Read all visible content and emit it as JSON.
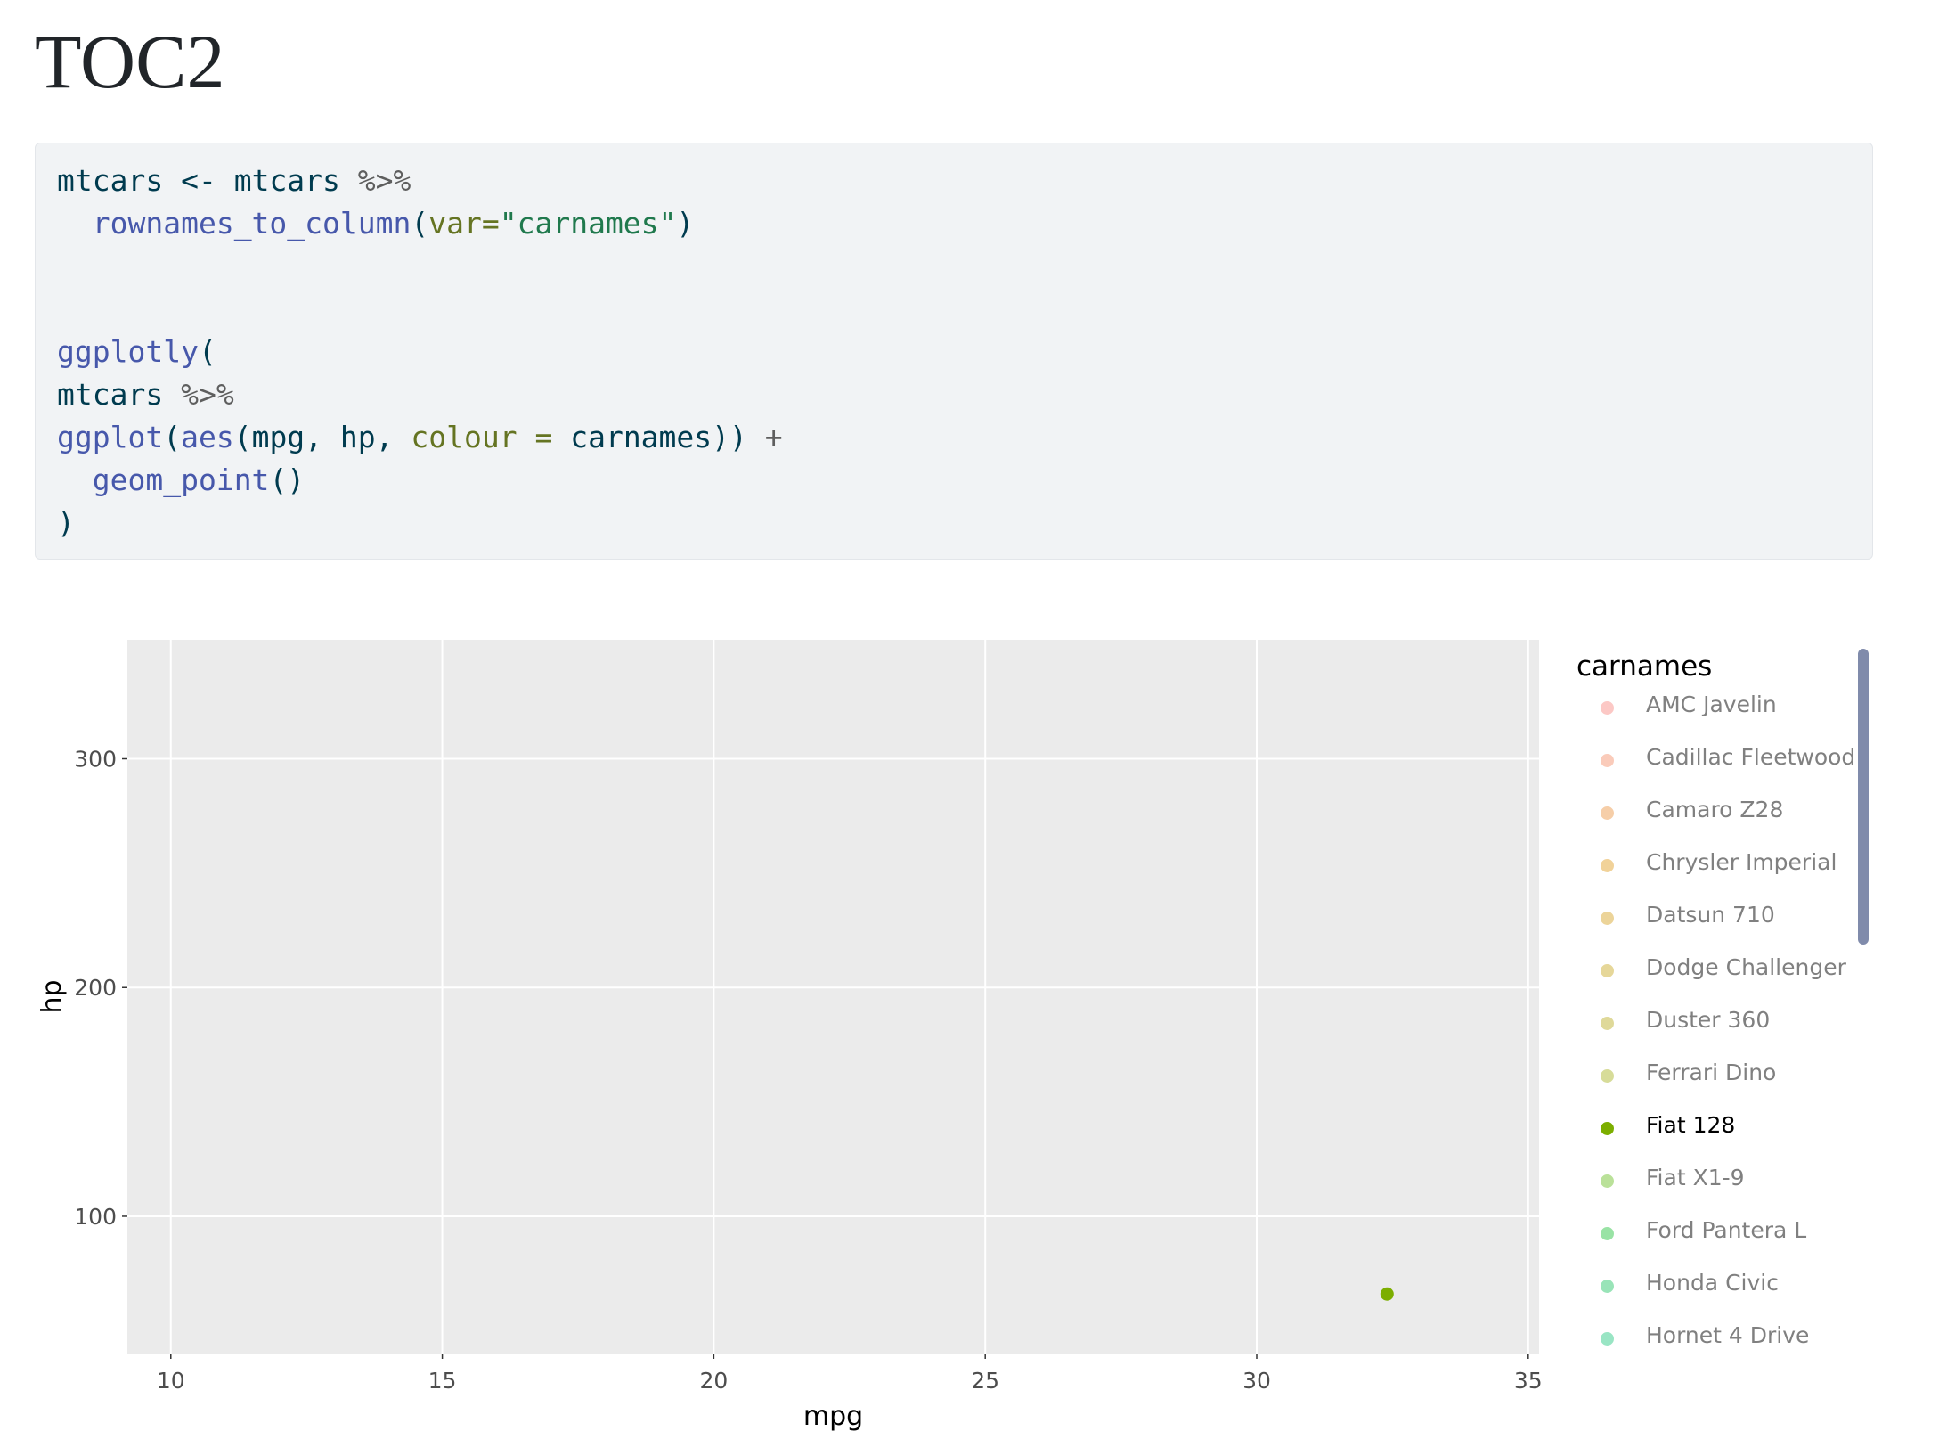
{
  "page": {
    "title": "TOC2"
  },
  "code": {
    "lines": [
      [
        {
          "t": "mtcars",
          "c": "var"
        },
        {
          "t": " <- ",
          "c": "var"
        },
        {
          "t": "mtcars",
          "c": "var"
        },
        {
          "t": " %>%",
          "c": "op"
        }
      ],
      [
        {
          "t": "  ",
          "c": "var"
        },
        {
          "t": "rownames_to_column",
          "c": "fn"
        },
        {
          "t": "(",
          "c": "var"
        },
        {
          "t": "var=",
          "c": "arg"
        },
        {
          "t": "\"carnames\"",
          "c": "str"
        },
        {
          "t": ")",
          "c": "var"
        }
      ],
      [],
      [],
      [
        {
          "t": "ggplotly",
          "c": "fn"
        },
        {
          "t": "(",
          "c": "var"
        }
      ],
      [
        {
          "t": "mtcars",
          "c": "var"
        },
        {
          "t": " %>%",
          "c": "op"
        }
      ],
      [
        {
          "t": "ggplot",
          "c": "fn"
        },
        {
          "t": "(",
          "c": "var"
        },
        {
          "t": "aes",
          "c": "fn"
        },
        {
          "t": "(mpg, hp, ",
          "c": "var"
        },
        {
          "t": "colour =",
          "c": "arg"
        },
        {
          "t": " carnames)) ",
          "c": "var"
        },
        {
          "t": "+",
          "c": "op"
        }
      ],
      [
        {
          "t": "  ",
          "c": "var"
        },
        {
          "t": "geom_point",
          "c": "fn"
        },
        {
          "t": "()",
          "c": "var"
        }
      ],
      [
        {
          "t": ")",
          "c": "var"
        }
      ]
    ]
  },
  "chart_data": {
    "type": "scatter",
    "xlabel": "mpg",
    "ylabel": "hp",
    "xlim": [
      9.2,
      35.2
    ],
    "ylim": [
      40,
      352
    ],
    "x_ticks": [
      10,
      15,
      20,
      25,
      30,
      35
    ],
    "y_ticks": [
      100,
      200,
      300
    ],
    "grid": true,
    "background": "#ebebeb",
    "legend_title": "carnames",
    "legend_placement": "right",
    "series": [
      {
        "name": "AMC Javelin",
        "color": "#f8766d",
        "visible": false,
        "points": []
      },
      {
        "name": "Cadillac Fleetwood",
        "color": "#f27d53",
        "visible": false,
        "points": []
      },
      {
        "name": "Camaro Z28",
        "color": "#e88526",
        "visible": false,
        "points": []
      },
      {
        "name": "Chrysler Imperial",
        "color": "#db8e00",
        "visible": false,
        "points": []
      },
      {
        "name": "Datsun 710",
        "color": "#cf9400",
        "visible": false,
        "points": []
      },
      {
        "name": "Dodge Challenger",
        "color": "#c09b00",
        "visible": false,
        "points": []
      },
      {
        "name": "Duster 360",
        "color": "#b0a100",
        "visible": false,
        "points": []
      },
      {
        "name": "Ferrari Dino",
        "color": "#9ca700",
        "visible": false,
        "points": []
      },
      {
        "name": "Fiat 128",
        "color": "#7cae00",
        "visible": true,
        "points": [
          {
            "x": 32.4,
            "y": 66
          }
        ]
      },
      {
        "name": "Fiat X1-9",
        "color": "#53b400",
        "visible": false,
        "points": []
      },
      {
        "name": "Ford Pantera L",
        "color": "#00b81f",
        "visible": false,
        "points": []
      },
      {
        "name": "Honda Civic",
        "color": "#00bb4e",
        "visible": false,
        "points": []
      },
      {
        "name": "Hornet 4 Drive",
        "color": "#00be6c",
        "visible": false,
        "points": []
      }
    ]
  }
}
